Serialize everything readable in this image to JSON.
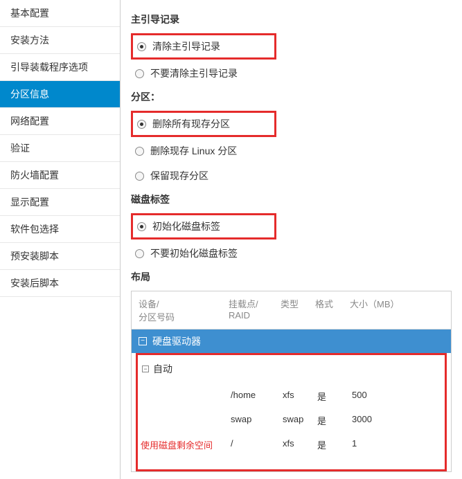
{
  "sidebar": {
    "items": [
      {
        "label": "基本配置"
      },
      {
        "label": "安装方法"
      },
      {
        "label": "引导装载程序选项"
      },
      {
        "label": "分区信息"
      },
      {
        "label": "网络配置"
      },
      {
        "label": "验证"
      },
      {
        "label": "防火墙配置"
      },
      {
        "label": "显示配置"
      },
      {
        "label": "软件包选择"
      },
      {
        "label": "预安装脚本"
      },
      {
        "label": "安装后脚本"
      }
    ],
    "activeIndex": 3
  },
  "sections": {
    "mbr": {
      "title": "主引导记录",
      "options": [
        {
          "label": "清除主引导记录",
          "selected": true,
          "highlighted": true
        },
        {
          "label": "不要清除主引导记录",
          "selected": false,
          "highlighted": false
        }
      ]
    },
    "partition": {
      "title": "分区：",
      "options": [
        {
          "label": "删除所有现存分区",
          "selected": true,
          "highlighted": true
        },
        {
          "label": "删除现存 Linux 分区",
          "selected": false,
          "highlighted": false
        },
        {
          "label": "保留现存分区",
          "selected": false,
          "highlighted": false
        }
      ]
    },
    "disklabel": {
      "title": "磁盘标签",
      "options": [
        {
          "label": "初始化磁盘标签",
          "selected": true,
          "highlighted": true
        },
        {
          "label": "不要初始化磁盘标签",
          "selected": false,
          "highlighted": false
        }
      ]
    },
    "layout": {
      "title": "布局",
      "headers": {
        "device": "设备/\n分区号码",
        "mount": "挂载点/\nRAID",
        "type": "类型",
        "format": "格式",
        "size": "大小（MB）"
      },
      "hddLabel": "硬盘驱动器",
      "autoLabel": "自动",
      "rows": [
        {
          "device": "",
          "mount": "/home",
          "type": "xfs",
          "format": "是",
          "size": "500"
        },
        {
          "device": "",
          "mount": "swap",
          "type": "swap",
          "format": "是",
          "size": "3000"
        },
        {
          "device": "使用磁盘剩余空间",
          "mount": "/",
          "type": "xfs",
          "format": "是",
          "size": "1"
        }
      ]
    }
  }
}
